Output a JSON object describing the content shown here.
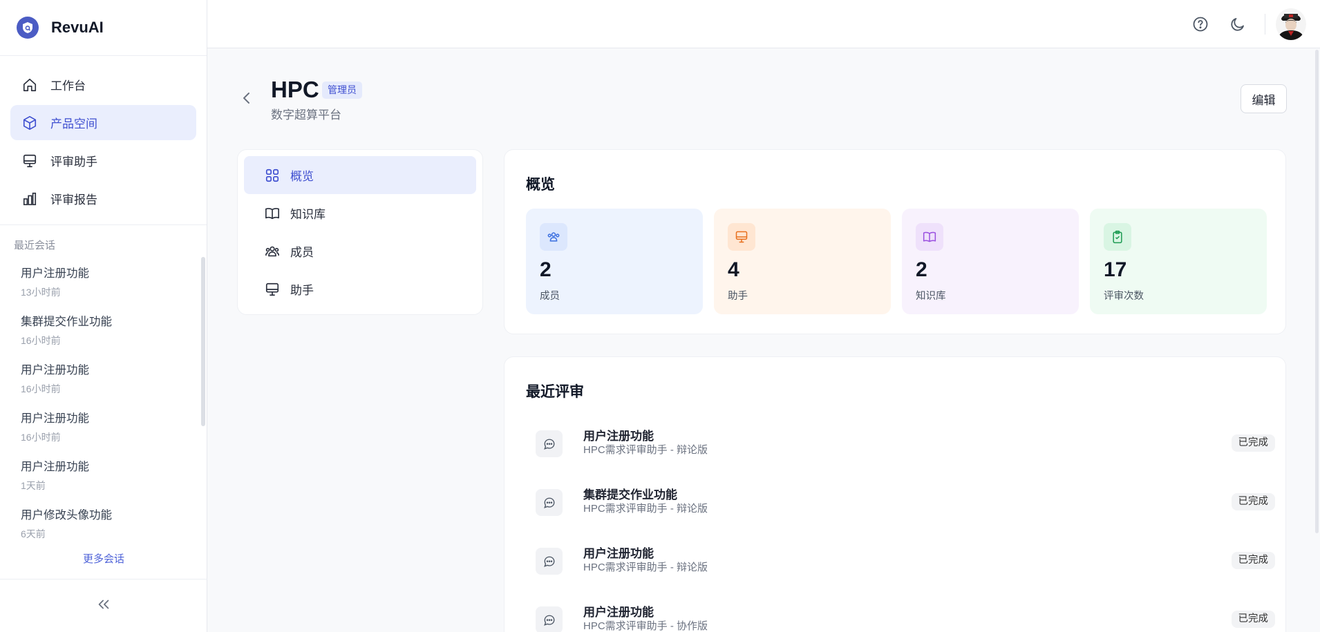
{
  "app": {
    "name": "RevuAI"
  },
  "sidebar": {
    "nav": [
      {
        "label": "工作台",
        "icon": "home-icon",
        "active": false
      },
      {
        "label": "产品空间",
        "icon": "box-icon",
        "active": true
      },
      {
        "label": "评审助手",
        "icon": "monitor-icon",
        "active": false
      },
      {
        "label": "评审报告",
        "icon": "bar-chart-icon",
        "active": false
      }
    ],
    "recent_title": "最近会话",
    "recent": [
      {
        "title": "用户注册功能",
        "time": "13小时前"
      },
      {
        "title": "集群提交作业功能",
        "time": "16小时前"
      },
      {
        "title": "用户注册功能",
        "time": "16小时前"
      },
      {
        "title": "用户注册功能",
        "time": "16小时前"
      },
      {
        "title": "用户注册功能",
        "time": "1天前"
      },
      {
        "title": "用户修改头像功能",
        "time": "6天前"
      }
    ],
    "more_label": "更多会话"
  },
  "topbar": {
    "icons": [
      "help-icon",
      "moon-icon"
    ]
  },
  "header": {
    "title": "HPC",
    "role": "管理员",
    "subtitle": "数字超算平台",
    "edit_label": "编辑"
  },
  "subnav": [
    {
      "label": "概览",
      "icon": "grid-icon",
      "active": true
    },
    {
      "label": "知识库",
      "icon": "book-icon",
      "active": false
    },
    {
      "label": "成员",
      "icon": "users-icon",
      "active": false
    },
    {
      "label": "助手",
      "icon": "monitor-icon",
      "active": false
    }
  ],
  "overview": {
    "title": "概览",
    "stats": [
      {
        "value": "2",
        "label": "成员",
        "bg": "#edf3fe",
        "icon_bg": "#dce7fd",
        "color": "#3b6fe0"
      },
      {
        "value": "4",
        "label": "助手",
        "bg": "#fff5ec",
        "icon_bg": "#ffe6d2",
        "color": "#e8701e"
      },
      {
        "value": "2",
        "label": "知识库",
        "bg": "#f8f2fd",
        "icon_bg": "#efe1fb",
        "color": "#9a4fe0"
      },
      {
        "value": "17",
        "label": "评审次数",
        "bg": "#effbf3",
        "icon_bg": "#d9f5e3",
        "color": "#1d9b52"
      }
    ]
  },
  "recent_reviews": {
    "title": "最近评审",
    "items": [
      {
        "title": "用户注册功能",
        "subtitle": "HPC需求评审助手 - 辩论版",
        "status": "已完成"
      },
      {
        "title": "集群提交作业功能",
        "subtitle": "HPC需求评审助手 - 辩论版",
        "status": "已完成"
      },
      {
        "title": "用户注册功能",
        "subtitle": "HPC需求评审助手 - 辩论版",
        "status": "已完成"
      },
      {
        "title": "用户注册功能",
        "subtitle": "HPC需求评审助手 - 协作版",
        "status": "已完成"
      }
    ]
  }
}
